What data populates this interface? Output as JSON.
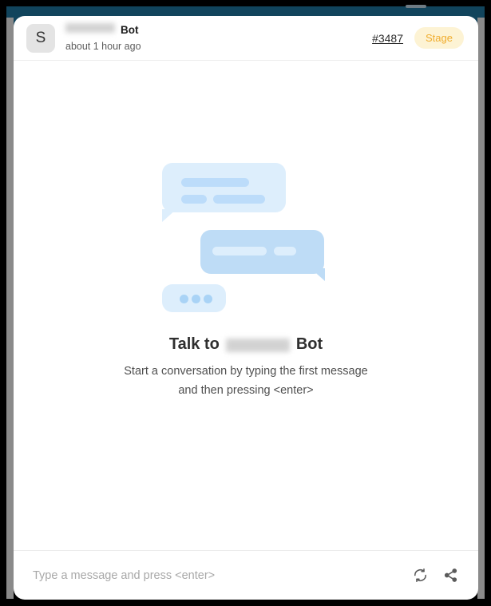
{
  "window": {
    "app_band_color": "#11445c",
    "card_background": "#ffffff"
  },
  "header": {
    "avatar_initial": "S",
    "bot_name_redacted": true,
    "bot_name_suffix": "Bot",
    "timestamp": "about 1 hour ago",
    "ticket_link": "#3487",
    "environment_badge": "Stage",
    "badge_color": "#f0ad2e",
    "badge_background": "#fdf3d4"
  },
  "empty_state": {
    "illustration": "chat-bubbles-illustration",
    "heading_prefix": "Talk to",
    "heading_redacted": true,
    "heading_suffix": "Bot",
    "subtext_line1": "Start a conversation by typing the first message",
    "subtext_line2": "and then pressing <enter>",
    "bubble_light_color": "#ddeefc",
    "bubble_medium_color": "#bedcf6",
    "bubble_line_color": "#bcdcfa"
  },
  "composer": {
    "placeholder": "Type a message and press <enter>",
    "value": "",
    "actions": [
      {
        "icon": "refresh-icon",
        "label": "Reset conversation"
      },
      {
        "icon": "share-icon",
        "label": "Share"
      }
    ]
  }
}
